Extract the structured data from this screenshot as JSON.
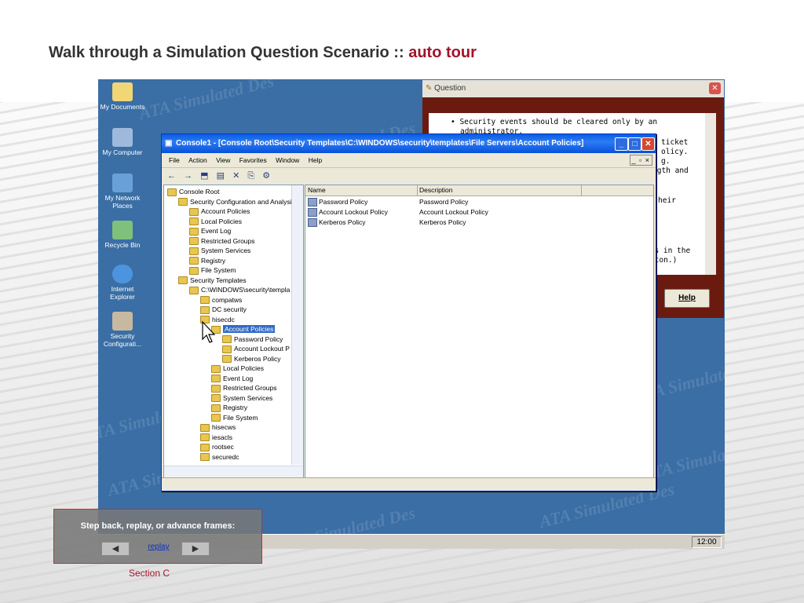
{
  "slide": {
    "title_main": "Walk through a Simulation Question Scenario ::",
    "title_accent": "auto tour",
    "section": "Section C"
  },
  "desktop": {
    "icons": [
      {
        "label": "My Documents",
        "icon": "documents-icon"
      },
      {
        "label": "My Computer",
        "icon": "computer-icon"
      },
      {
        "label": "My Network Places",
        "icon": "network-icon"
      },
      {
        "label": "Recycle Bin",
        "icon": "recycle-bin-icon"
      },
      {
        "label": "Internet Explorer",
        "icon": "ie-icon"
      },
      {
        "label": "Security Configurati...",
        "icon": "security-config-icon"
      }
    ],
    "watermark": "ATA Simulated Des",
    "clock": "12:00"
  },
  "question_dialog": {
    "title": "Question",
    "lines": [
      "• Security events should be cleared only by an",
      "  administrator.",
      "ticket",
      "olicy.",
      "g.",
      "ngth and",
      "heir",
      "ons in the",
      "tton.)"
    ],
    "help_button": "Help"
  },
  "console": {
    "title": "Console1 - [Console Root\\Security Templates\\C:\\WINDOWS\\security\\templates\\File Servers\\Account Policies]",
    "menu": [
      "File",
      "Action",
      "View",
      "Favorites",
      "Window",
      "Help"
    ],
    "mdi_controls": "_ ̅ x",
    "tree": [
      {
        "label": "Console Root",
        "indent": 0
      },
      {
        "label": "Security Configuration and Analysi",
        "indent": 1
      },
      {
        "label": "Account Policies",
        "indent": 2
      },
      {
        "label": "Local Policies",
        "indent": 2
      },
      {
        "label": "Event Log",
        "indent": 2
      },
      {
        "label": "Restricted Groups",
        "indent": 2
      },
      {
        "label": "System Services",
        "indent": 2
      },
      {
        "label": "Registry",
        "indent": 2
      },
      {
        "label": "File System",
        "indent": 2
      },
      {
        "label": "Security Templates",
        "indent": 1
      },
      {
        "label": "C:\\WINDOWS\\security\\templa",
        "indent": 2
      },
      {
        "label": "compatws",
        "indent": 3
      },
      {
        "label": "DC security",
        "indent": 3
      },
      {
        "label": "hisecdc",
        "indent": 3
      },
      {
        "label": "Account Policies",
        "indent": 4,
        "selected": true
      },
      {
        "label": "Password Policy",
        "indent": 5
      },
      {
        "label": "Account Lockout P",
        "indent": 5
      },
      {
        "label": "Kerberos Policy",
        "indent": 5
      },
      {
        "label": "Local Policies",
        "indent": 4
      },
      {
        "label": "Event Log",
        "indent": 4
      },
      {
        "label": "Restricted Groups",
        "indent": 4
      },
      {
        "label": "System Services",
        "indent": 4
      },
      {
        "label": "Registry",
        "indent": 4
      },
      {
        "label": "File System",
        "indent": 4
      },
      {
        "label": "hisecws",
        "indent": 3
      },
      {
        "label": "iesacls",
        "indent": 3
      },
      {
        "label": "rootsec",
        "indent": 3
      },
      {
        "label": "securedc",
        "indent": 3
      }
    ],
    "list_headers": [
      "Name",
      "Description"
    ],
    "list_rows": [
      {
        "name": "Password Policy",
        "description": "Password Policy"
      },
      {
        "name": "Account Lockout Policy",
        "description": "Account Lockout Policy"
      },
      {
        "name": "Kerberos Policy",
        "description": "Kerberos Policy"
      }
    ]
  },
  "nav": {
    "label": "Step back, replay, or advance frames:",
    "back": "◀",
    "replay": "replay",
    "forward": "▶"
  }
}
